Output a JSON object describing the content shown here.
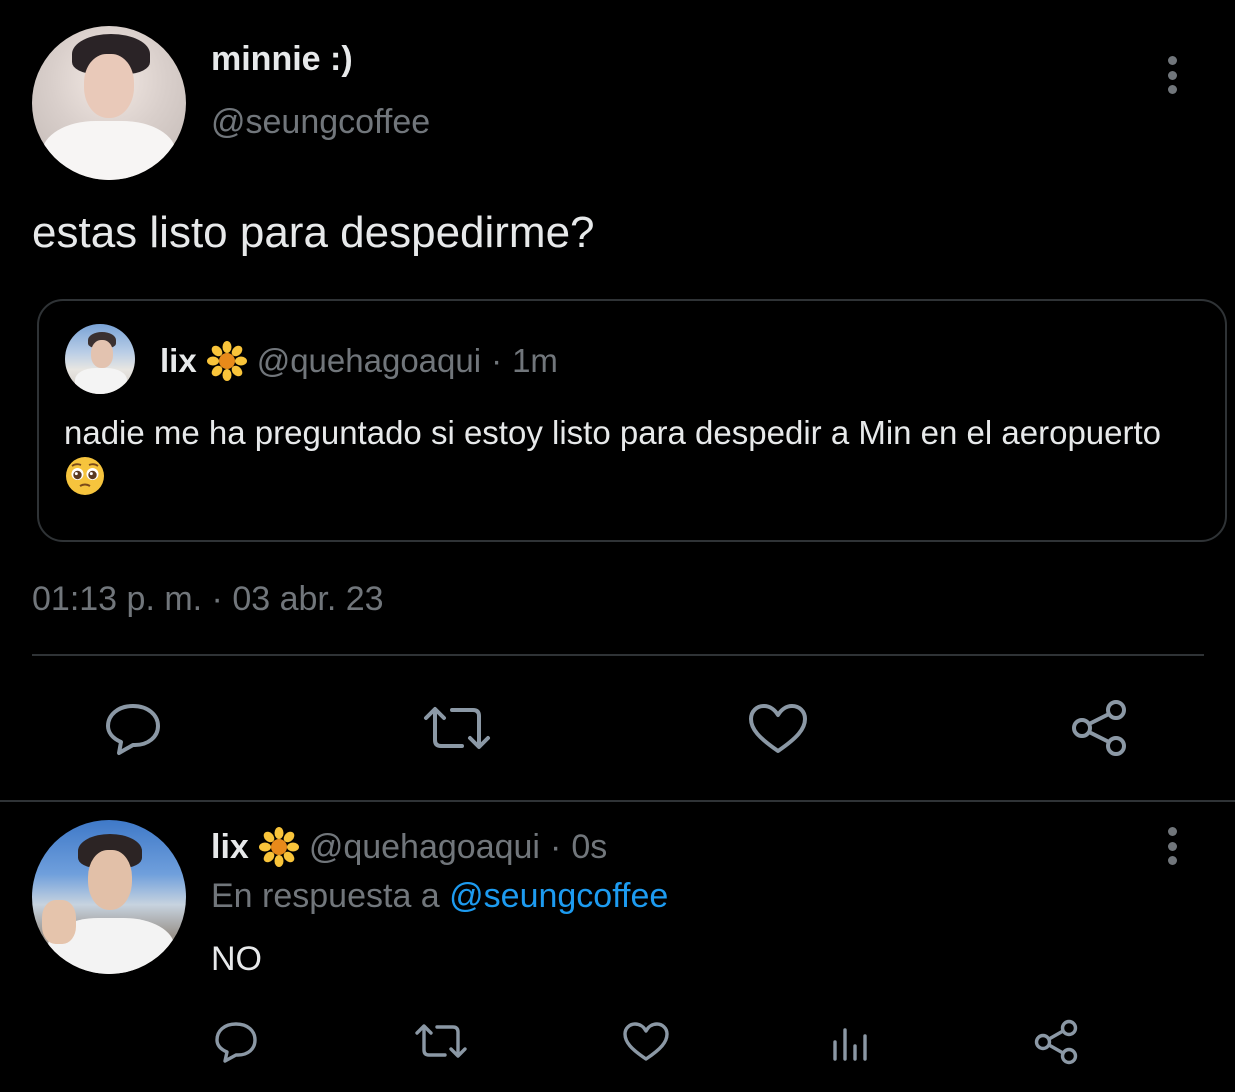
{
  "main_tweet": {
    "display_name": "minnie :)",
    "handle": "@seungcoffee",
    "text": "estas listo para despedirme?",
    "timestamp": "01:13 p. m. · 03 abr. 23",
    "quoted": {
      "display_name": "lix",
      "handle": "@quehagoaqui",
      "separator": "·",
      "time": "1m",
      "text": "nadie me ha preguntado si estoy listo para despedir a Min en el aeropuerto",
      "emoji": "pleading-face"
    }
  },
  "reply_tweet": {
    "display_name": "lix",
    "handle": "@quehagoaqui",
    "separator": "·",
    "time": "0s",
    "reply_prefix": "En respuesta a",
    "reply_mention": "@seungcoffee",
    "text": "NO"
  },
  "icons": {
    "reply": "reply-icon",
    "retweet": "retweet-icon",
    "like": "heart-icon",
    "share": "share-icon",
    "views": "analytics-icon",
    "more": "more-vertical-icon",
    "name_emoji": "sunflower-icon"
  },
  "colors": {
    "background": "#000000",
    "text_primary": "#e7e9ea",
    "text_secondary": "#71767b",
    "link": "#1d9bf0",
    "border": "#2f3336",
    "icon": "#8b98a5"
  }
}
